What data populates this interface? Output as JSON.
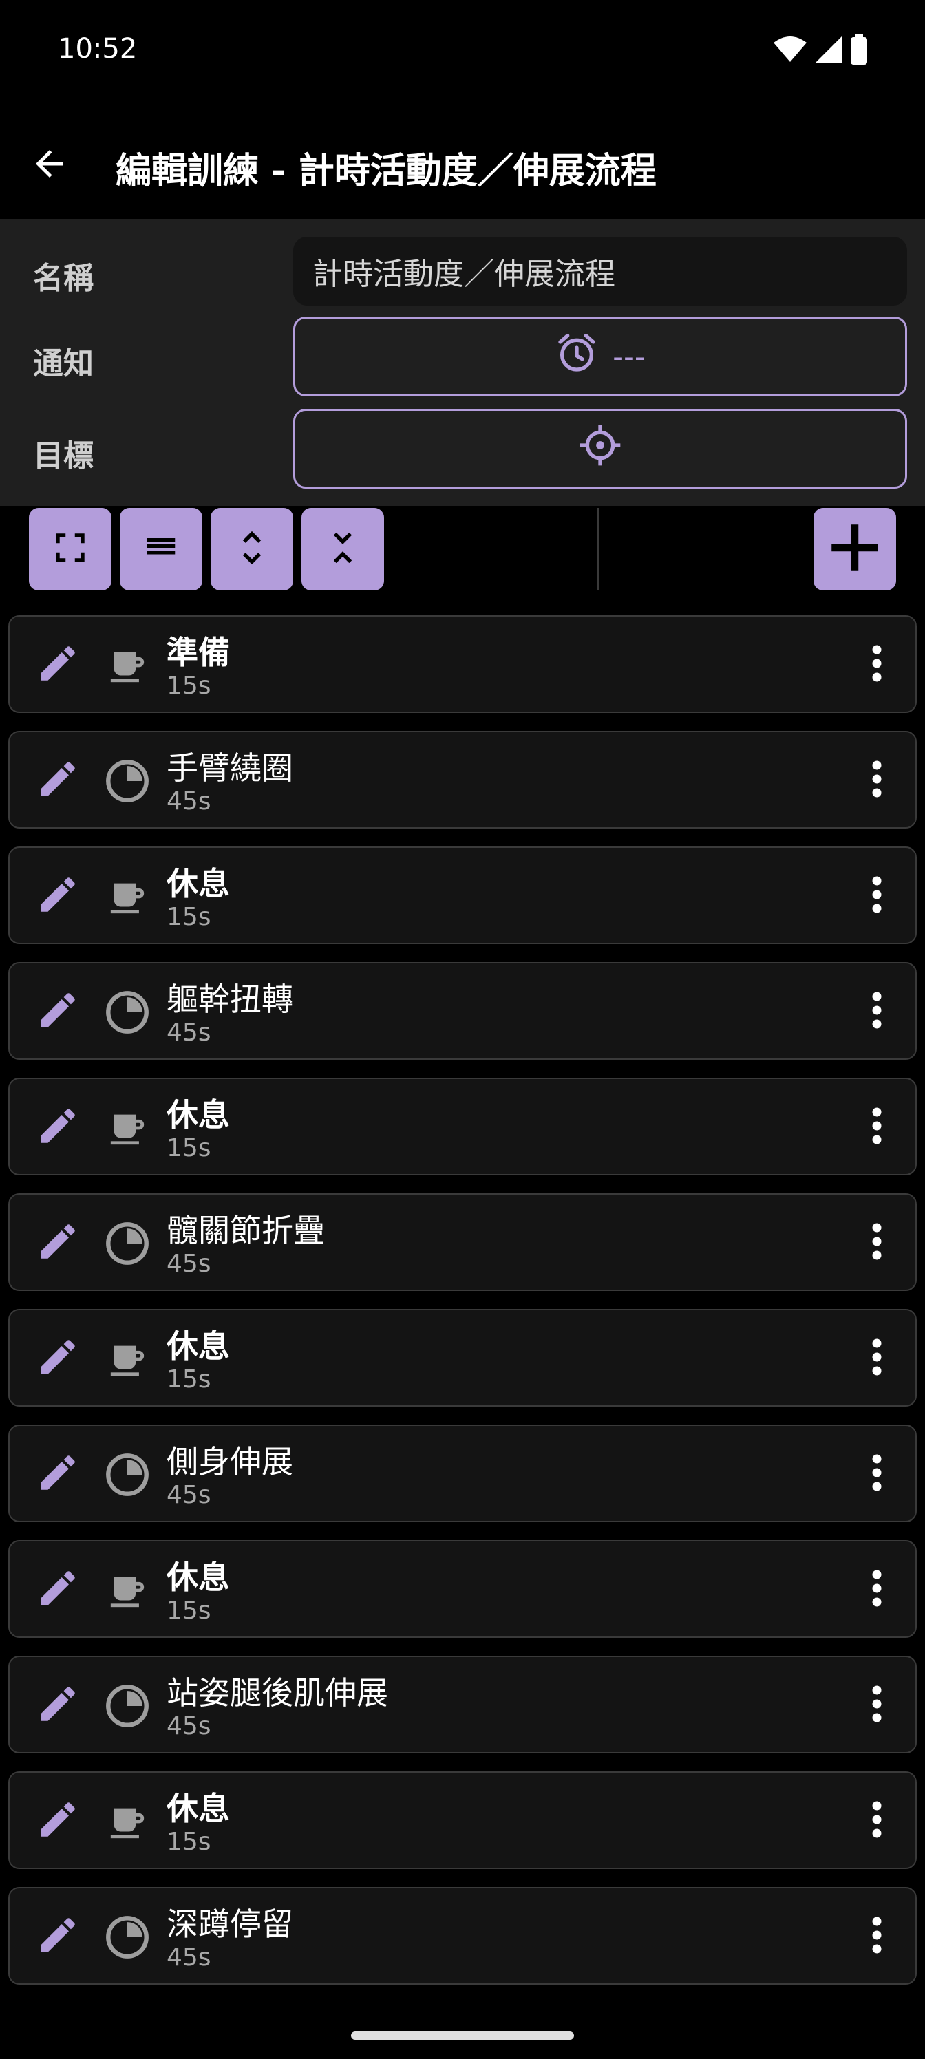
{
  "status_bar": {
    "time": "10:52"
  },
  "app_bar": {
    "title": "編輯訓練 - 計時活動度／伸展流程"
  },
  "form": {
    "name_label": "名稱",
    "name_value": "計時活動度／伸展流程",
    "notify_label": "通知",
    "notify_value": "---",
    "target_label": "目標"
  },
  "toolbar": {
    "icons": [
      "fullscreen-icon",
      "reorder-icon",
      "expand-all-icon",
      "collapse-all-icon",
      "add-icon"
    ]
  },
  "items": [
    {
      "name": "準備",
      "duration": "15s",
      "kind": "rest"
    },
    {
      "name": "手臂繞圈",
      "duration": "45s",
      "kind": "timer"
    },
    {
      "name": "休息",
      "duration": "15s",
      "kind": "rest"
    },
    {
      "name": "軀幹扭轉",
      "duration": "45s",
      "kind": "timer"
    },
    {
      "name": "休息",
      "duration": "15s",
      "kind": "rest"
    },
    {
      "name": "髖關節折疊",
      "duration": "45s",
      "kind": "timer"
    },
    {
      "name": "休息",
      "duration": "15s",
      "kind": "rest"
    },
    {
      "name": "側身伸展",
      "duration": "45s",
      "kind": "timer"
    },
    {
      "name": "休息",
      "duration": "15s",
      "kind": "rest"
    },
    {
      "name": "站姿腿後肌伸展",
      "duration": "45s",
      "kind": "timer"
    },
    {
      "name": "休息",
      "duration": "15s",
      "kind": "rest"
    },
    {
      "name": "深蹲停留",
      "duration": "45s",
      "kind": "timer"
    }
  ],
  "colors": {
    "accent": "#b39ddb",
    "background": "#000000",
    "panel": "#1f1f1f",
    "card": "#141414",
    "card_border": "#3a3a3a",
    "secondary_text": "#a8a8a8"
  }
}
